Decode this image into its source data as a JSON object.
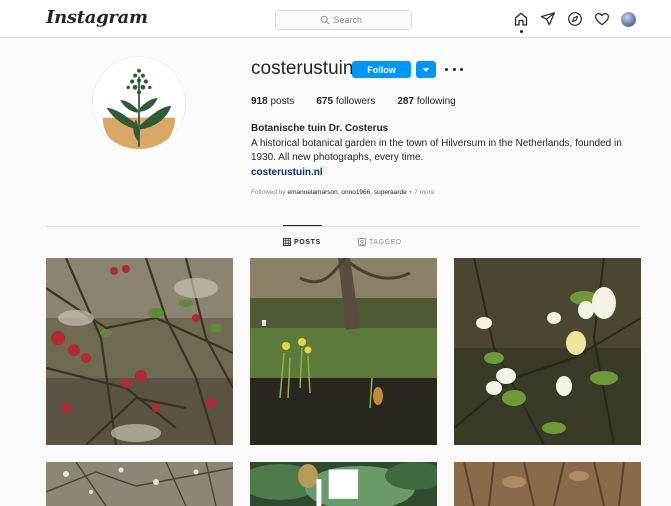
{
  "header": {
    "logo": "Instagram",
    "search_placeholder": "Search",
    "nav_icons": [
      "home-icon",
      "direct-icon",
      "explore-icon",
      "activity-heart-icon",
      "profile-avatar"
    ]
  },
  "profile": {
    "username": "costerustuin",
    "follow_label": "Follow",
    "stats": [
      {
        "count": "918",
        "label": "posts"
      },
      {
        "count": "675",
        "label": "followers"
      },
      {
        "count": "287",
        "label": "following"
      }
    ],
    "full_name": "Botanische tuin Dr. Costerus",
    "bio": "A historical botanical garden in the town of Hilversum in the Netherlands, founded in 1930. All new photographs, every time.",
    "website": "costerustuin.nl",
    "followed_by": {
      "prefix": "Followed by ",
      "names": [
        "emanuelamarson",
        "onno1966",
        "superaarde"
      ],
      "more": "+ 7 more"
    }
  },
  "tabs": [
    {
      "label": "POSTS",
      "icon": "grid-icon",
      "active": true
    },
    {
      "label": "TAGGED",
      "icon": "tagged-icon",
      "active": false
    }
  ],
  "posts": [
    {
      "subject": "quince-branches-red-buds"
    },
    {
      "subject": "daffodils-under-tree"
    },
    {
      "subject": "white-honeysuckle-flowers"
    },
    {
      "subject": "frosted-shrub-branches"
    },
    {
      "subject": "hellebore-leaves",
      "multiple": true
    },
    {
      "subject": "tree-bark"
    }
  ],
  "colors": {
    "accent": "#0095f6",
    "link": "#00376b",
    "muted": "#8e8e8e",
    "border": "#dbdbdb",
    "avatar_tan": "#d9a766",
    "avatar_green": "#2f5b36"
  }
}
